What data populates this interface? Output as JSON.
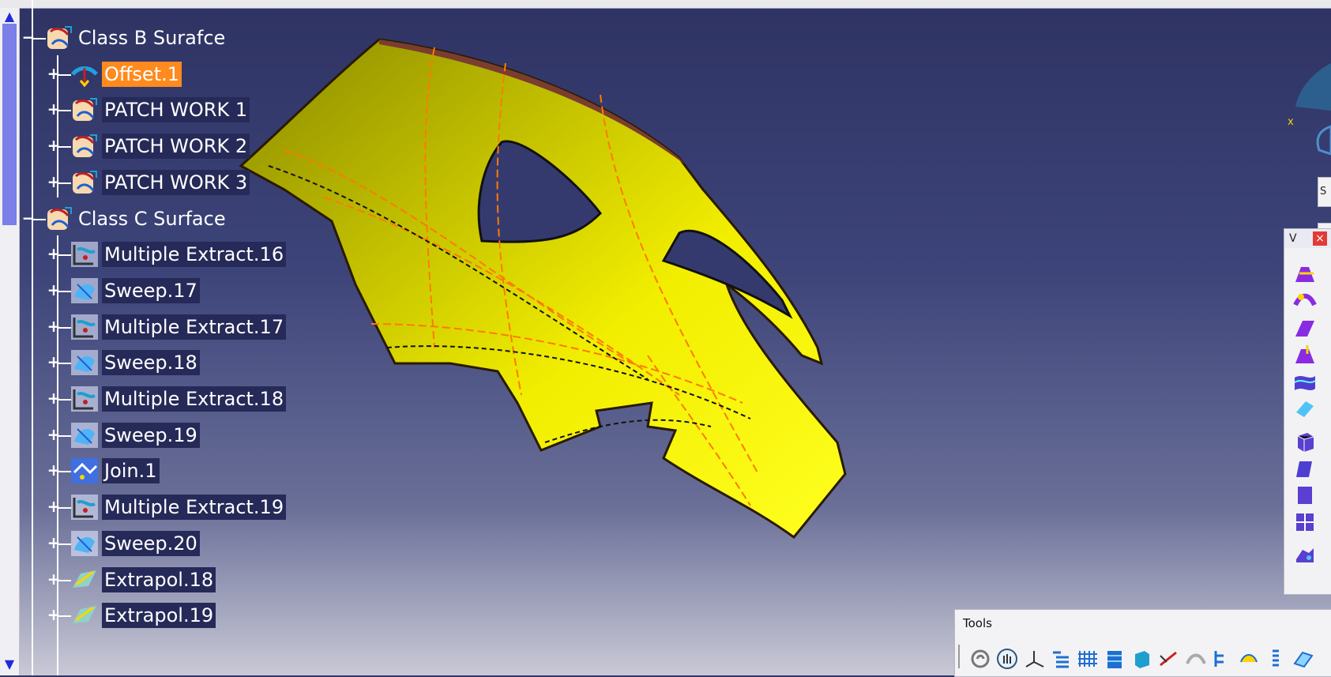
{
  "tree": {
    "nodes": [
      {
        "label": "Class B Surafce",
        "level": 0,
        "toggle": "−",
        "icon": "geometrical-set-icon",
        "style": "plain"
      },
      {
        "label": "Offset.1",
        "level": 1,
        "toggle": "+",
        "icon": "offset-icon",
        "style": "sel"
      },
      {
        "label": "PATCH WORK 1",
        "level": 1,
        "toggle": "+",
        "icon": "geometrical-set-icon",
        "style": "dark"
      },
      {
        "label": "PATCH WORK 2",
        "level": 1,
        "toggle": "+",
        "icon": "geometrical-set-icon",
        "style": "dark"
      },
      {
        "label": "PATCH WORK 3",
        "level": 1,
        "toggle": "+",
        "icon": "geometrical-set-icon",
        "style": "dark"
      },
      {
        "label": "Class C Surface",
        "level": 0,
        "toggle": "−",
        "icon": "geometrical-set-icon",
        "style": "plain"
      },
      {
        "label": "Multiple Extract.16",
        "level": 1,
        "toggle": "+",
        "icon": "multiple-extract-icon",
        "style": "dark"
      },
      {
        "label": "Sweep.17",
        "level": 1,
        "toggle": "+",
        "icon": "sweep-icon",
        "style": "dark"
      },
      {
        "label": "Multiple Extract.17",
        "level": 1,
        "toggle": "+",
        "icon": "multiple-extract-icon",
        "style": "dark"
      },
      {
        "label": "Sweep.18",
        "level": 1,
        "toggle": "+",
        "icon": "sweep-icon",
        "style": "dark"
      },
      {
        "label": "Multiple Extract.18",
        "level": 1,
        "toggle": "+",
        "icon": "multiple-extract-icon",
        "style": "dark"
      },
      {
        "label": "Sweep.19",
        "level": 1,
        "toggle": "+",
        "icon": "sweep-icon",
        "style": "dark"
      },
      {
        "label": "Join.1",
        "level": 1,
        "toggle": "+",
        "icon": "join-icon",
        "style": "dark"
      },
      {
        "label": "Multiple Extract.19",
        "level": 1,
        "toggle": "+",
        "icon": "multiple-extract-icon",
        "style": "dark"
      },
      {
        "label": "Sweep.20",
        "level": 1,
        "toggle": "+",
        "icon": "sweep-icon",
        "style": "dark"
      },
      {
        "label": "Extrapol.18",
        "level": 1,
        "toggle": "+",
        "icon": "extrapolate-icon",
        "style": "dark"
      },
      {
        "label": "Extrapol.19",
        "level": 1,
        "toggle": "+",
        "icon": "extrapolate-icon",
        "style": "dark"
      }
    ]
  },
  "compass": {
    "axis_label": "x"
  },
  "view_toolbar": {
    "title": "V",
    "close_label": "×",
    "side_stub_label": "S"
  },
  "tools_toolbar": {
    "title": "Tools"
  },
  "colors": {
    "viewport_top": "#2e3363",
    "viewport_bottom": "#c9c9d6",
    "surface": "#f2ee00",
    "selection": "#ff8a1e",
    "tree_label_bg": "#262a58"
  }
}
